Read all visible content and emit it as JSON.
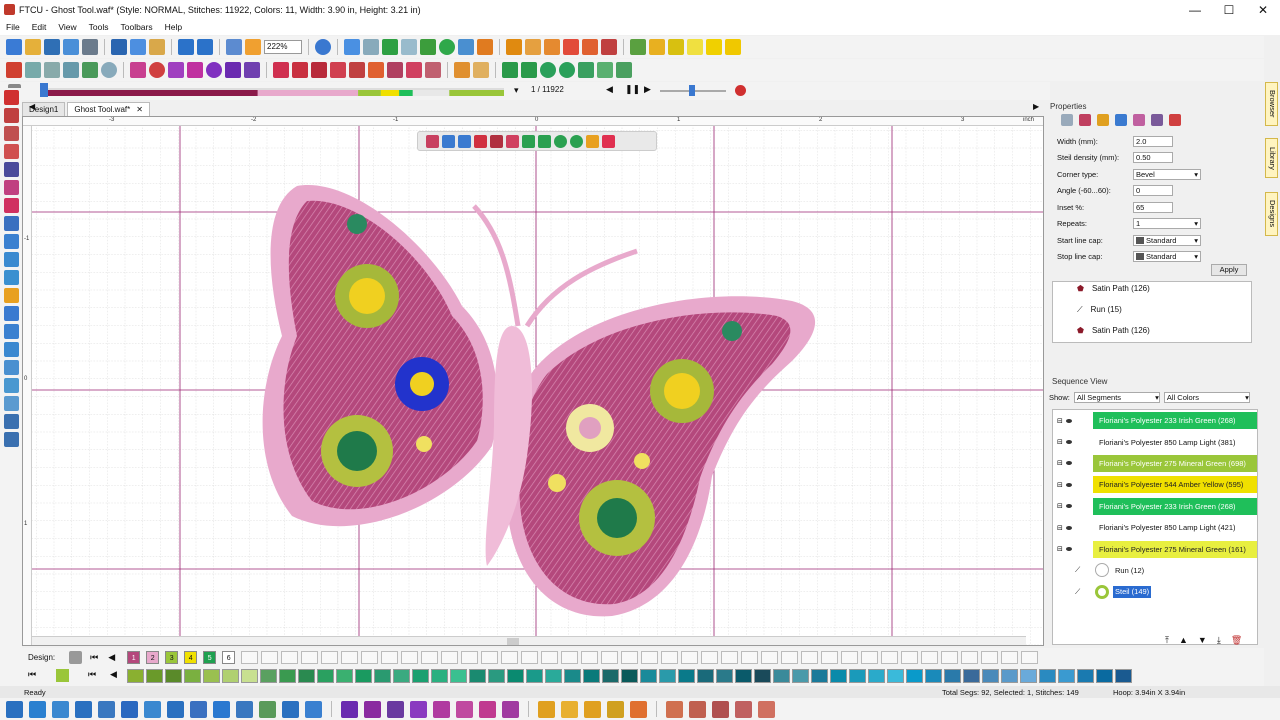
{
  "window": {
    "title": "FTCU - Ghost Tool.waf* (Style: NORMAL, Stitches: 11922, Colors: 11, Width: 3.90 in, Height: 3.21 in)",
    "min": "—",
    "max": "☐",
    "close": "✕"
  },
  "menu": [
    "File",
    "Edit",
    "View",
    "Tools",
    "Toolbars",
    "Help"
  ],
  "toolbar": {
    "zoom": "222%"
  },
  "progress": {
    "counter": "1 / 11922",
    "fraction": 0.0
  },
  "tabs": [
    {
      "label": "Design1",
      "active": false
    },
    {
      "label": "Ghost Tool.waf*",
      "active": true,
      "close": "✕"
    }
  ],
  "ruler": {
    "top": [
      "-3",
      "-2",
      "-1",
      "0",
      "1",
      "2",
      "3"
    ],
    "unit": "inch",
    "left": [
      "-1",
      "0",
      "1"
    ]
  },
  "properties": {
    "title": "Properties",
    "fields": [
      {
        "label": "Width (mm):",
        "value": "2.0",
        "type": "input"
      },
      {
        "label": "Steil density (mm):",
        "value": "0.50",
        "type": "input"
      },
      {
        "label": "Corner type:",
        "value": "Bevel",
        "type": "select"
      },
      {
        "label": "Angle (-60...60):",
        "value": "0",
        "type": "input"
      },
      {
        "label": "Inset %:",
        "value": "65",
        "type": "input"
      },
      {
        "label": "Repeats:",
        "value": "1",
        "type": "select"
      },
      {
        "label": "Start line cap:",
        "value": "Standard",
        "type": "select"
      },
      {
        "label": "Stop line cap:",
        "value": "Standard",
        "type": "select"
      }
    ],
    "apply": "Apply",
    "objects": [
      "Satin Path (126)",
      "Run (15)",
      "Satin Path (126)"
    ]
  },
  "sequence": {
    "title": "Sequence View",
    "show_label": "Show:",
    "segments_filter": "All Segments",
    "colors_filter": "All Colors",
    "rows": [
      {
        "label": "Floriani's Polyester 233 Irish Green (268)",
        "color": "#1fbf5a",
        "text": "#ffffff"
      },
      {
        "label": "Floriani's Polyester 850 Lamp Light (381)",
        "color": "#ffffff",
        "text": "#111111"
      },
      {
        "label": "Floriani's Polyester 275 Mineral Green (698)",
        "color": "#9ac63a",
        "text": "#ffffff"
      },
      {
        "label": "Floriani's Polyester 544 Amber Yellow (595)",
        "color": "#f0e000",
        "text": "#222222"
      },
      {
        "label": "Floriani's Polyester 233 Irish Green (268)",
        "color": "#1fbf5a",
        "text": "#ffffff"
      },
      {
        "label": "Floriani's Polyester 850 Lamp Light (421)",
        "color": "#ffffff",
        "text": "#111111"
      },
      {
        "label": "Floriani's Polyester 275 Mineral Green (161)",
        "color": "#e8ef40",
        "text": "#222222"
      }
    ],
    "subrows": [
      {
        "label": "Run (12)"
      },
      {
        "label": "Steil (149)",
        "selected": true
      }
    ]
  },
  "side_tabs": [
    "Browser",
    "Library",
    "Designs"
  ],
  "design_bar": {
    "label": "Design:",
    "colors": [
      "1",
      "2",
      "3",
      "4",
      "5",
      "6"
    ]
  },
  "status": {
    "left": "Ready",
    "middle": "Total Segs: 92, Selected: 1, Stitches: 149",
    "right": "Hoop: 3.94in X 3.94in"
  },
  "colors": {
    "accent": "#8b2a5a",
    "butterfly_light": "#e8a9cc",
    "butterfly_dark": "#b4487c",
    "grid": "#9a2370"
  }
}
